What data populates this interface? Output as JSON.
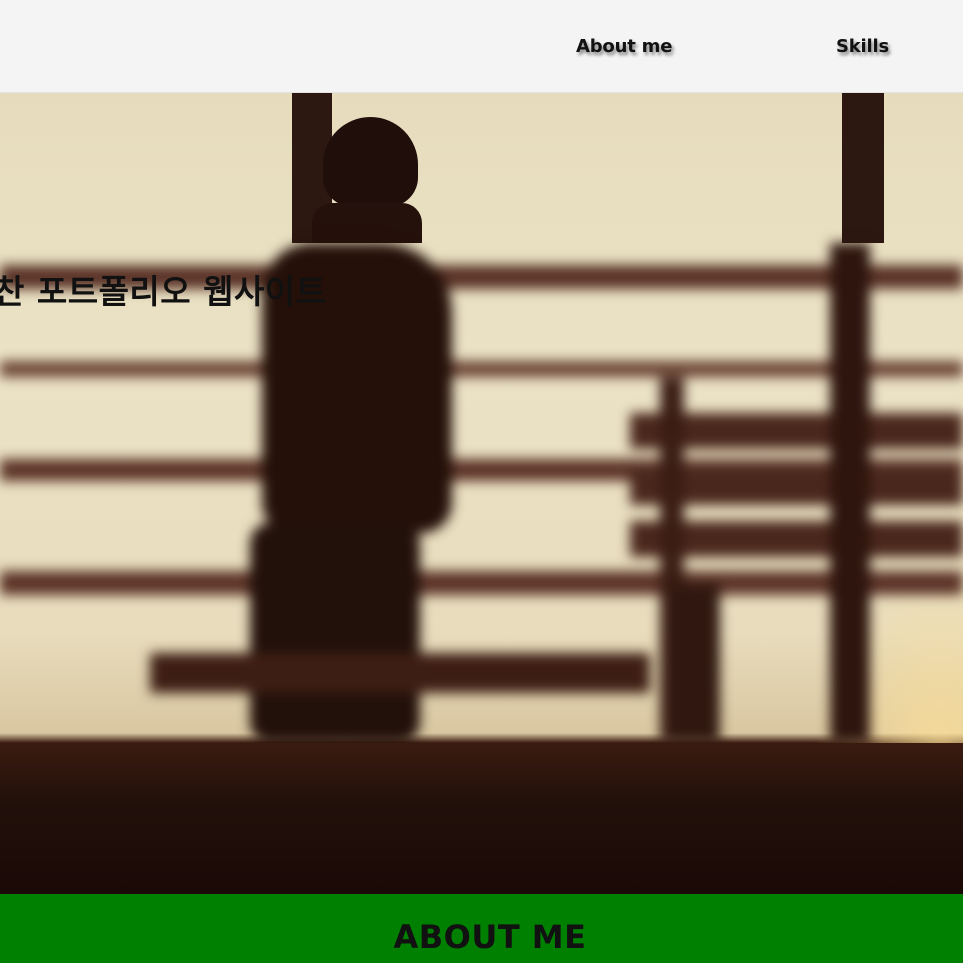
{
  "nav": {
    "links": [
      {
        "label": "About me"
      },
      {
        "label": "Skills"
      }
    ]
  },
  "hero": {
    "title": "찬 포트폴리오 웹사이트"
  },
  "about": {
    "heading": "ABOUT ME"
  },
  "colors": {
    "navbar_bg": "#f4f4f4",
    "about_bg": "#008000",
    "text": "#111111"
  }
}
